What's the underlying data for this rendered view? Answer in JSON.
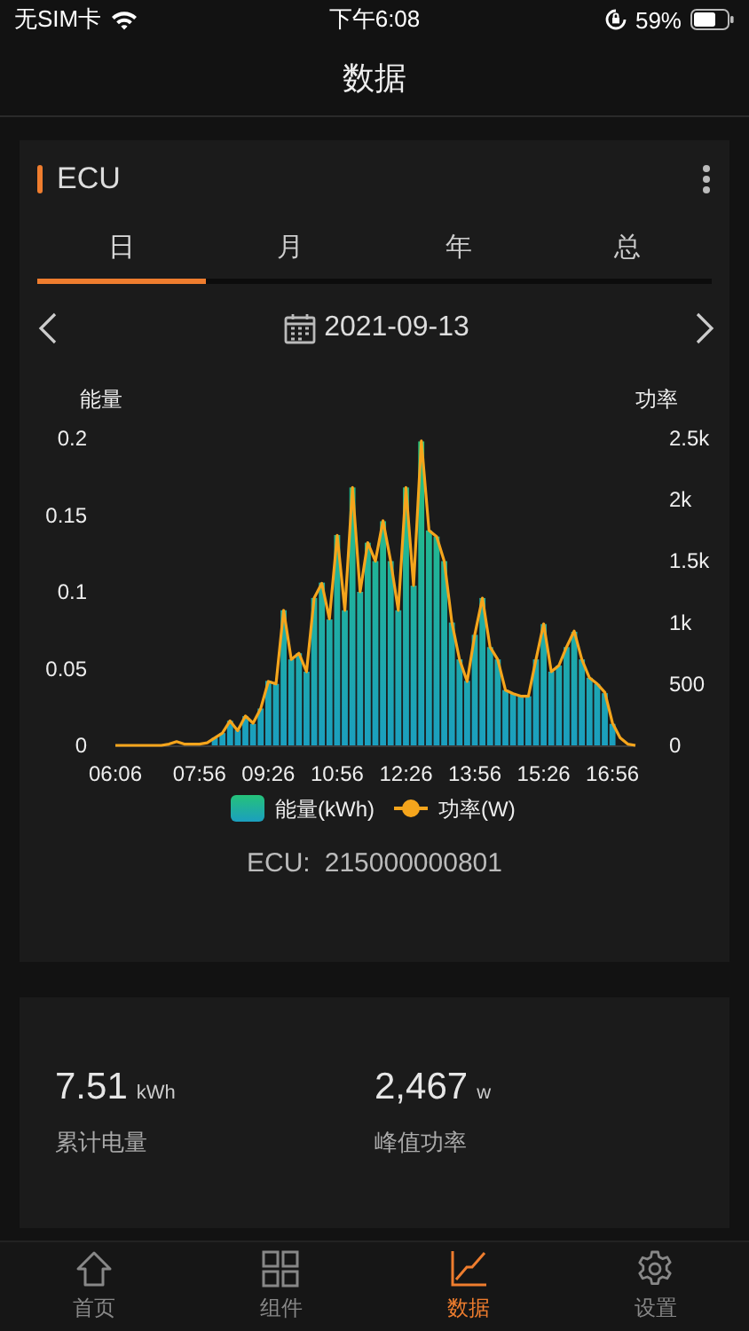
{
  "status_bar": {
    "carrier": "无SIM卡",
    "time": "下午6:08",
    "battery": "59%"
  },
  "title": "数据",
  "device_card": {
    "name": "ECU",
    "tabs": [
      {
        "label": "日",
        "selected": true
      },
      {
        "label": "月",
        "selected": false
      },
      {
        "label": "年",
        "selected": false
      },
      {
        "label": "总",
        "selected": false
      }
    ],
    "date": "2021-09-13",
    "charts": [
      {
        "chart_data": {
          "type": "bar",
          "ylabel": "能量",
          "ylim": [
            0,
            0.2
          ],
          "yticks": [
            0,
            0.05,
            0.1,
            0.15,
            0.2
          ],
          "xlim": [
            366,
            1046
          ],
          "xticks": [
            {
              "value": 366,
              "label": "06:06"
            },
            {
              "value": 476,
              "label": "07:56"
            },
            {
              "value": 566,
              "label": "09:26"
            },
            {
              "value": 656,
              "label": "10:56"
            },
            {
              "value": 746,
              "label": "12:26"
            },
            {
              "value": 836,
              "label": "13:56"
            },
            {
              "value": 926,
              "label": "15:26"
            },
            {
              "value": 1016,
              "label": "16:56"
            }
          ],
          "x": [
            496,
            506,
            516,
            526,
            536,
            546,
            556,
            566,
            576,
            586,
            596,
            606,
            616,
            626,
            636,
            646,
            656,
            666,
            676,
            686,
            696,
            706,
            716,
            726,
            736,
            746,
            756,
            766,
            776,
            786,
            796,
            806,
            816,
            826,
            836,
            846,
            856,
            866,
            876,
            886,
            896,
            906,
            916,
            926,
            936,
            946,
            956,
            966,
            976,
            986,
            996,
            1006,
            1016
          ],
          "series": [
            {
              "name": "能量(kWh)",
              "values": [
                0.005,
                0.008,
                0.016,
                0.01,
                0.019,
                0.014,
                0.024,
                0.042,
                0.04,
                0.088,
                0.056,
                0.06,
                0.048,
                0.096,
                0.106,
                0.082,
                0.137,
                0.088,
                0.168,
                0.1,
                0.132,
                0.12,
                0.146,
                0.12,
                0.088,
                0.168,
                0.104,
                0.198,
                0.14,
                0.136,
                0.12,
                0.08,
                0.056,
                0.042,
                0.072,
                0.096,
                0.064,
                0.056,
                0.036,
                0.034,
                0.032,
                0.032,
                0.056,
                0.079,
                0.048,
                0.052,
                0.064,
                0.074,
                0.056,
                0.044,
                0.04,
                0.034,
                0.014
              ]
            }
          ]
        }
      },
      {
        "chart_data": {
          "type": "line",
          "ylabel": "功率",
          "ylim": [
            0,
            2500
          ],
          "xlim": [
            366,
            1046
          ],
          "yticks": [
            {
              "value": 0,
              "label": "0"
            },
            {
              "value": 500,
              "label": "500"
            },
            {
              "value": 1000,
              "label": "1k"
            },
            {
              "value": 1500,
              "label": "1.5k"
            },
            {
              "value": 2000,
              "label": "2k"
            },
            {
              "value": 2500,
              "label": "2.5k"
            }
          ],
          "x": [
            366,
            376,
            386,
            406,
            426,
            436,
            446,
            456,
            466,
            476,
            486,
            496,
            506,
            516,
            526,
            536,
            546,
            556,
            566,
            576,
            586,
            596,
            606,
            616,
            626,
            636,
            646,
            656,
            666,
            676,
            686,
            696,
            706,
            716,
            726,
            736,
            746,
            756,
            766,
            776,
            786,
            796,
            806,
            816,
            826,
            836,
            846,
            856,
            866,
            876,
            886,
            896,
            906,
            916,
            926,
            936,
            946,
            956,
            966,
            976,
            986,
            996,
            1006,
            1016,
            1026,
            1036,
            1046
          ],
          "series": [
            {
              "name": "功率(W)",
              "color": "#f5a51c",
              "values": [
                0,
                0,
                0,
                0,
                0,
                10,
                30,
                10,
                10,
                10,
                20,
                60,
                100,
                200,
                120,
                240,
                180,
                300,
                520,
                500,
                1100,
                700,
                750,
                600,
                1200,
                1320,
                1030,
                1710,
                1100,
                2100,
                1250,
                1650,
                1500,
                1830,
                1500,
                1100,
                2100,
                1300,
                2480,
                1750,
                1700,
                1500,
                1000,
                700,
                520,
                900,
                1200,
                800,
                700,
                450,
                420,
                400,
                400,
                700,
                990,
                600,
                650,
                800,
                930,
                700,
                550,
                500,
                430,
                180,
                60,
                10,
                0
              ]
            }
          ]
        }
      }
    ],
    "ecu_label": "ECU:",
    "ecu_id": "215000000801"
  },
  "summary": [
    {
      "value": "7.51",
      "unit": "kWh",
      "label": "累计电量"
    },
    {
      "value": "2,467",
      "unit": "w",
      "label": "峰值功率"
    }
  ],
  "tab_bar": [
    {
      "label": "首页",
      "selected": false
    },
    {
      "label": "组件",
      "selected": false
    },
    {
      "label": "数据",
      "selected": true
    },
    {
      "label": "设置",
      "selected": false
    }
  ]
}
